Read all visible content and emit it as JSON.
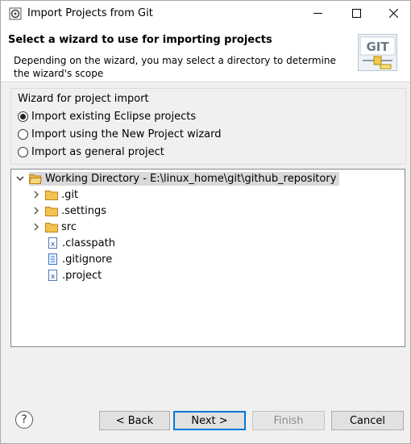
{
  "window": {
    "title": "Import Projects from Git",
    "icon": "eclipse-dialog-icon",
    "controls": [
      "minimize",
      "maximize",
      "close"
    ]
  },
  "header": {
    "title": "Select a wizard to use for importing projects",
    "description": "Depending on the wizard, you may select a directory to determine the wizard's scope",
    "logo_text": "GIT"
  },
  "wizard_group": {
    "label": "Wizard for project import",
    "options": [
      {
        "label": "Import existing Eclipse projects",
        "selected": true
      },
      {
        "label": "Import using the New Project wizard",
        "selected": false
      },
      {
        "label": "Import as general project",
        "selected": false
      }
    ]
  },
  "tree": {
    "root": {
      "label": "Working Directory - E:\\linux_home\\git\\github_repository",
      "expanded": true,
      "selected": true
    },
    "children": [
      {
        "label": ".git",
        "type": "folder",
        "expandable": true
      },
      {
        "label": ".settings",
        "type": "folder",
        "expandable": true
      },
      {
        "label": "src",
        "type": "folder",
        "expandable": true
      },
      {
        "label": ".classpath",
        "type": "xml-file"
      },
      {
        "label": ".gitignore",
        "type": "text-file"
      },
      {
        "label": ".project",
        "type": "xml-file"
      }
    ]
  },
  "buttons": {
    "help": "?",
    "back": "< Back",
    "next": "Next >",
    "finish": "Finish",
    "cancel": "Cancel"
  },
  "colors": {
    "accent": "#0078d7",
    "selection": "#d9d9d9",
    "folder": "#e8b84a"
  }
}
